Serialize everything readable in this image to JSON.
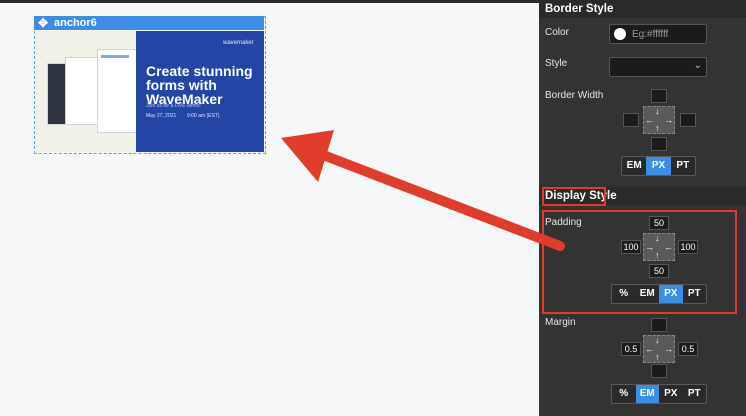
{
  "canvas": {
    "anchor_label": "anchor6",
    "thumbnail": {
      "logo": "wavemaker",
      "headline": "Create stunning forms with WaveMaker",
      "subline": "Join us for a LIVE demo!",
      "date": "May 27, 2021",
      "time": "9:00 am (EST)"
    }
  },
  "panel": {
    "border_style": {
      "title": "Border Style",
      "color_label": "Color",
      "color_placeholder": "Eg:#ffffff",
      "style_label": "Style",
      "width_label": "Border Width",
      "units": [
        "EM",
        "PX",
        "PT"
      ],
      "active_unit": "PX"
    },
    "display_style": {
      "title": "Display Style",
      "padding_label": "Padding",
      "padding": {
        "top": "50",
        "right": "100",
        "bottom": "50",
        "left": "100"
      },
      "padding_units": [
        "%",
        "EM",
        "PX",
        "PT"
      ],
      "padding_active_unit": "PX",
      "margin_label": "Margin",
      "margin": {
        "top": "",
        "right": "0.5",
        "bottom": "",
        "left": "0.5"
      },
      "margin_units": [
        "%",
        "EM",
        "PX",
        "PT"
      ],
      "margin_active_unit": "EM"
    }
  },
  "colors": {
    "accent": "#3a8ee6",
    "annotation": "#e13b2c",
    "panel_bg": "#333333",
    "thumb_blue": "#2346a6"
  }
}
